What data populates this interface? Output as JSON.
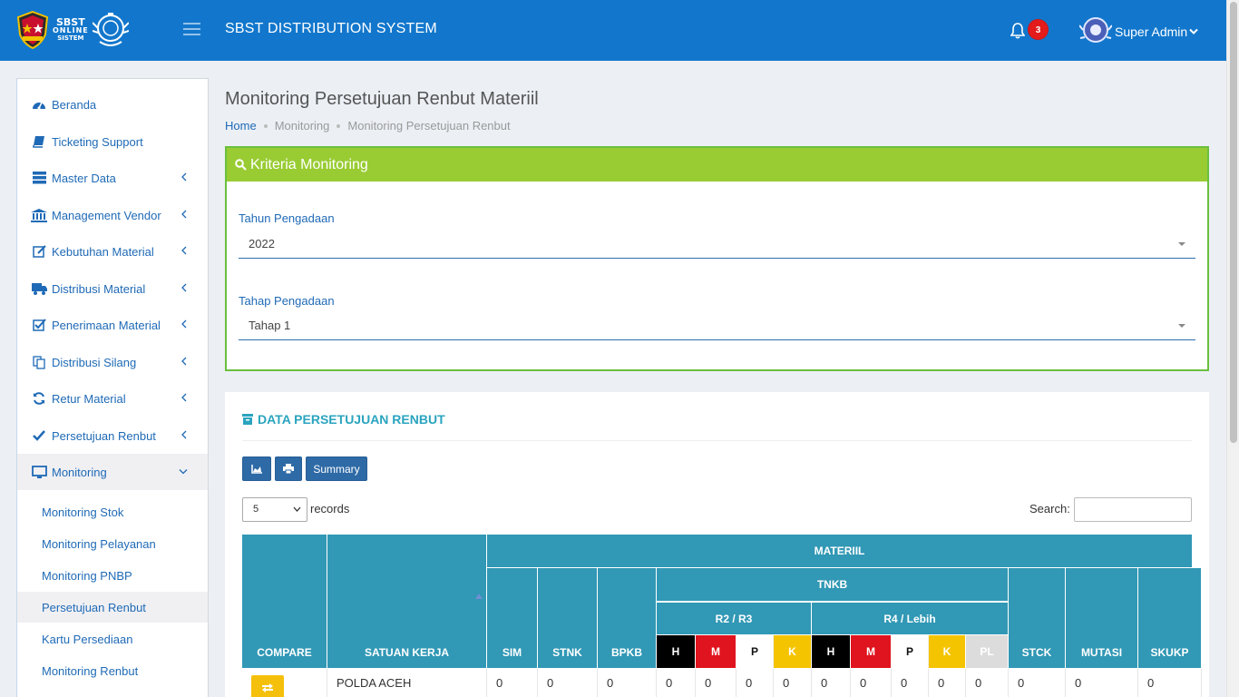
{
  "header": {
    "logo": {
      "line1": "SBST",
      "line2": "ONLINE",
      "line3": "SISTEM"
    },
    "title": "SBST DISTRIBUTION SYSTEM",
    "notification_count": "3",
    "user_name": "Super Admin"
  },
  "colors": {
    "header_bg": "#1277cc",
    "criteria_header": "#99cc33",
    "table_header": "#3198b5",
    "link": "#1f6ab6"
  },
  "sidebar": {
    "items": [
      {
        "label": "Beranda",
        "icon": "dashboard-icon"
      },
      {
        "label": "Ticketing Support",
        "icon": "book-icon"
      },
      {
        "label": "Master Data",
        "icon": "server-icon"
      },
      {
        "label": "Management Vendor",
        "icon": "bank-icon"
      },
      {
        "label": "Kebutuhan Material",
        "icon": "edit-icon"
      },
      {
        "label": "Distribusi Material",
        "icon": "truck-icon"
      },
      {
        "label": "Penerimaan Material",
        "icon": "check-square-icon"
      },
      {
        "label": "Distribusi Silang",
        "icon": "copy-icon"
      },
      {
        "label": "Retur Material",
        "icon": "refresh-icon"
      },
      {
        "label": "Persetujuan Renbut",
        "icon": "check-icon"
      },
      {
        "label": "Monitoring",
        "icon": "monitor-icon"
      }
    ],
    "subitems": [
      {
        "label": "Monitoring Stok"
      },
      {
        "label": "Monitoring Pelayanan"
      },
      {
        "label": "Monitoring PNBP"
      },
      {
        "label": "Persetujuan Renbut"
      },
      {
        "label": "Kartu Persediaan"
      },
      {
        "label": "Monitoring Renbut"
      }
    ]
  },
  "page": {
    "title": "Monitoring Persetujuan Renbut Materiil",
    "breadcrumb": [
      "Home",
      "Monitoring",
      "Monitoring Persetujuan Renbut"
    ]
  },
  "criteria": {
    "title": "Kriteria Monitoring",
    "year_label": "Tahun Pengadaan",
    "year_value": "2022",
    "stage_label": "Tahap Pengadaan",
    "stage_value": "Tahap 1"
  },
  "data": {
    "title": "DATA PERSETUJUAN RENBUT",
    "summary_label": "Summary",
    "page_length": "5",
    "records_label": "records",
    "search_label": "Search:",
    "table": {
      "compare": "COMPARE",
      "satuan_kerja": "SATUAN KERJA",
      "materiil": "MATERIIL",
      "sim": "SIM",
      "stnk": "STNK",
      "bpkb": "BPKB",
      "tnkb": "TNKB",
      "r2r3": "R2 / R3",
      "r4": "R4 / Lebih",
      "stck": "STCK",
      "mutasi": "MUTASI",
      "skukp": "SKUKP",
      "color_codes_r2": [
        "H",
        "M",
        "P",
        "K"
      ],
      "color_codes_r4": [
        "H",
        "M",
        "P",
        "K",
        "PL"
      ],
      "rows": [
        {
          "satuan_kerja": "POLDA ACEH",
          "values": [
            "0",
            "0",
            "0",
            "0",
            "0",
            "0",
            "0",
            "0",
            "0",
            "0",
            "0",
            "0",
            "0",
            "0",
            "0"
          ]
        }
      ]
    }
  }
}
